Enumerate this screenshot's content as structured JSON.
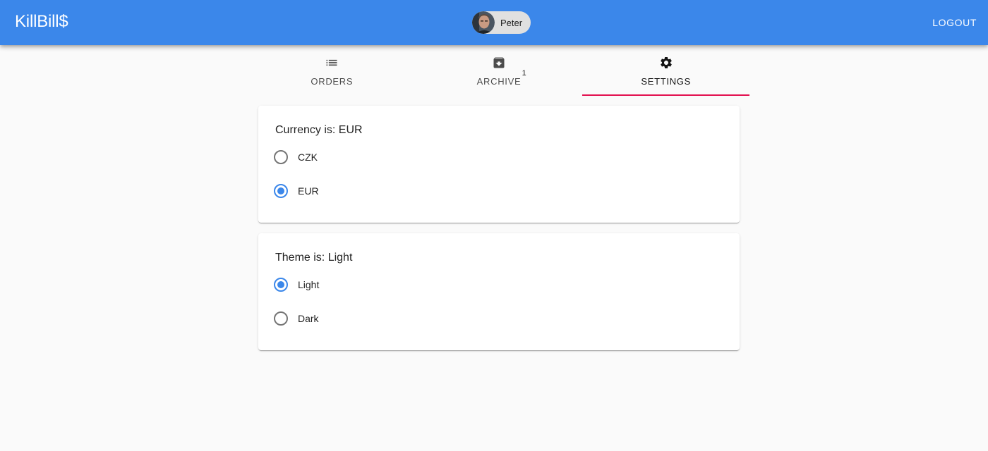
{
  "app": {
    "title": "KillBill$"
  },
  "header": {
    "user": {
      "name": "Peter"
    },
    "logout_label": "LOGOUT"
  },
  "tabs": [
    {
      "label": "ORDERS",
      "icon": "list-icon",
      "active": false
    },
    {
      "label": "ARCHIVE",
      "icon": "archive-icon",
      "badge": "1",
      "active": false
    },
    {
      "label": "SETTINGS",
      "icon": "gear-icon",
      "active": true
    }
  ],
  "settings": {
    "currency": {
      "title": "Currency is: EUR",
      "options": [
        {
          "label": "CZK",
          "selected": false
        },
        {
          "label": "EUR",
          "selected": true
        }
      ]
    },
    "theme": {
      "title": "Theme is: Light",
      "options": [
        {
          "label": "Light",
          "selected": true
        },
        {
          "label": "Dark",
          "selected": false
        }
      ]
    }
  },
  "colors": {
    "primary": "#3b87ea",
    "tab_indicator": "#e3104f",
    "background": "#fafafa"
  }
}
